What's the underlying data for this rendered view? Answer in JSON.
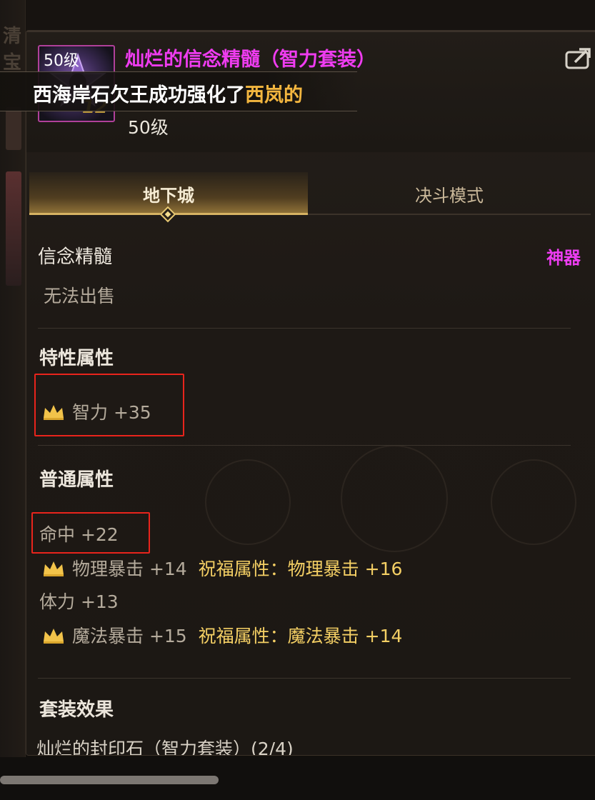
{
  "item": {
    "icon_level": "50级",
    "icon_number": "12",
    "name": "灿烂的信念精髓（智力套装）",
    "level": "50级"
  },
  "chat": {
    "prefix": "西海岸石欠王成功强化了",
    "highlight": "西岚的"
  },
  "tabs": [
    {
      "label": "地下城",
      "active": true
    },
    {
      "label": "决斗模式",
      "active": false
    }
  ],
  "info": {
    "type": "信念精髓",
    "rarity": "神器",
    "sell": "无法出售"
  },
  "special_stats": {
    "title": "特性属性",
    "items": [
      {
        "text": "智力 +35",
        "crown": true
      }
    ]
  },
  "normal_stats": {
    "title": "普通属性",
    "items": [
      {
        "text": "命中 +22",
        "crown": false
      },
      {
        "text": "物理暴击 +14",
        "bless": "祝福属性：物理暴击 +16",
        "crown": true
      },
      {
        "text": "体力 +13",
        "crown": false
      },
      {
        "text": "魔法暴击 +15",
        "bless": "祝福属性：魔法暴击 +14",
        "crown": true
      }
    ]
  },
  "set": {
    "title": "套装效果",
    "name": "灿烂的封印石（智力套装）(2/4)"
  },
  "background": {
    "left_text": "清宝"
  },
  "colors": {
    "rarity_pink": "#ee3df2",
    "gold": "#f4cf64",
    "highlight_box": "#e8241c"
  }
}
